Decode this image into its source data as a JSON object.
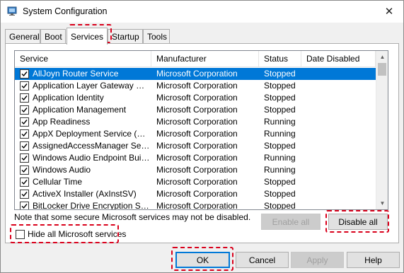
{
  "window": {
    "title": "System Configuration",
    "close_symbol": "✕"
  },
  "tabs": [
    {
      "label": "General"
    },
    {
      "label": "Boot"
    },
    {
      "label": "Services"
    },
    {
      "label": "Startup"
    },
    {
      "label": "Tools"
    }
  ],
  "services": {
    "columns": [
      "Service",
      "Manufacturer",
      "Status",
      "Date Disabled"
    ],
    "rows": [
      {
        "name": "AllJoyn Router Service",
        "manufacturer": "Microsoft Corporation",
        "status": "Stopped",
        "date_disabled": "",
        "checked": true,
        "selected": true
      },
      {
        "name": "Application Layer Gateway Service",
        "manufacturer": "Microsoft Corporation",
        "status": "Stopped",
        "date_disabled": "",
        "checked": true
      },
      {
        "name": "Application Identity",
        "manufacturer": "Microsoft Corporation",
        "status": "Stopped",
        "date_disabled": "",
        "checked": true
      },
      {
        "name": "Application Management",
        "manufacturer": "Microsoft Corporation",
        "status": "Stopped",
        "date_disabled": "",
        "checked": true
      },
      {
        "name": "App Readiness",
        "manufacturer": "Microsoft Corporation",
        "status": "Running",
        "date_disabled": "",
        "checked": true
      },
      {
        "name": "AppX Deployment Service (AppX...",
        "manufacturer": "Microsoft Corporation",
        "status": "Running",
        "date_disabled": "",
        "checked": true
      },
      {
        "name": "AssignedAccessManager Service",
        "manufacturer": "Microsoft Corporation",
        "status": "Stopped",
        "date_disabled": "",
        "checked": true
      },
      {
        "name": "Windows Audio Endpoint Builder",
        "manufacturer": "Microsoft Corporation",
        "status": "Running",
        "date_disabled": "",
        "checked": true
      },
      {
        "name": "Windows Audio",
        "manufacturer": "Microsoft Corporation",
        "status": "Running",
        "date_disabled": "",
        "checked": true
      },
      {
        "name": "Cellular Time",
        "manufacturer": "Microsoft Corporation",
        "status": "Stopped",
        "date_disabled": "",
        "checked": true
      },
      {
        "name": "ActiveX Installer (AxInstSV)",
        "manufacturer": "Microsoft Corporation",
        "status": "Stopped",
        "date_disabled": "",
        "checked": true
      },
      {
        "name": "BitLocker Drive Encryption Service",
        "manufacturer": "Microsoft Corporation",
        "status": "Stopped",
        "date_disabled": "",
        "checked": true
      }
    ]
  },
  "note": "Note that some secure Microsoft services may not be disabled.",
  "buttons": {
    "enable_all": "Enable all",
    "disable_all": "Disable all",
    "ok": "OK",
    "cancel": "Cancel",
    "apply": "Apply",
    "help": "Help"
  },
  "hide_microsoft_services": {
    "label": "Hide all Microsoft services",
    "checked": false
  },
  "colors": {
    "selection": "#0078d7",
    "highlight_annotation": "#d9001b"
  }
}
